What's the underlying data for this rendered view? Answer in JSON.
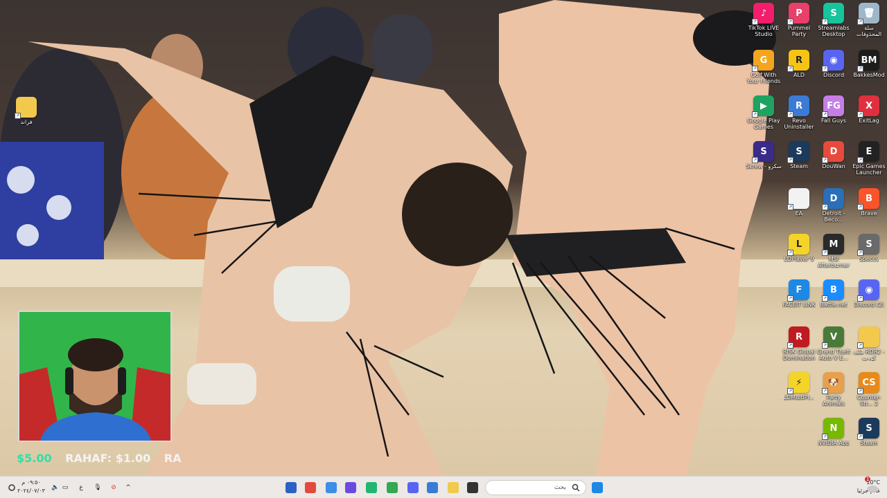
{
  "desktop_icons": [
    {
      "label": "TikTok LIVE Studio",
      "icon": "tiktok-icon",
      "color": "#f21d6b",
      "glyph": "♪"
    },
    {
      "label": "Pummel Party",
      "icon": "pummel-party-icon",
      "color": "#e83f6b",
      "glyph": "P"
    },
    {
      "label": "Streamlabs Desktop",
      "icon": "streamlabs-icon",
      "color": "#17c49b",
      "glyph": "S"
    },
    {
      "label": "سلة المحذوفات",
      "icon": "recycle-bin-icon",
      "color": "#9fb6c9",
      "glyph": "🗑"
    },
    {
      "label": "Golf With Your Friends",
      "icon": "golf-icon",
      "color": "#f3a51d",
      "glyph": "G"
    },
    {
      "label": "ALD",
      "icon": "rockstar-icon",
      "color": "#f7c413",
      "glyph": "R"
    },
    {
      "label": "Discord",
      "icon": "discord-icon",
      "color": "#5865f2",
      "glyph": "◉"
    },
    {
      "label": "BakkesMod",
      "icon": "bakkesmod-icon",
      "color": "#1c1c1c",
      "glyph": "BM"
    },
    {
      "label": "Google Play Games",
      "icon": "google-play-games-icon",
      "color": "#1ea362",
      "glyph": "▶"
    },
    {
      "label": "Revo Uninstaller",
      "icon": "revo-uninstaller-icon",
      "color": "#3b7bd6",
      "glyph": "R"
    },
    {
      "label": "Fall Guys",
      "icon": "fall-guys-icon",
      "color": "#c67ee7",
      "glyph": "FG"
    },
    {
      "label": "ExitLag",
      "icon": "exitlag-icon",
      "color": "#e03040",
      "glyph": "X"
    },
    {
      "label": "Skrew - سكرو",
      "icon": "skrew-icon",
      "color": "#3a2a8a",
      "glyph": "S"
    },
    {
      "label": "Steam",
      "icon": "steam-icon",
      "color": "#1b3a5c",
      "glyph": "S"
    },
    {
      "label": "DouWan",
      "icon": "douwan-icon",
      "color": "#e84a3c",
      "glyph": "D"
    },
    {
      "label": "Epic Games Launcher",
      "icon": "epic-games-icon",
      "color": "#222222",
      "glyph": "E"
    },
    {
      "label": "EA",
      "icon": "ea-file-icon",
      "color": "#f2f2f2",
      "glyph": ""
    },
    {
      "label": "Detroit - Beco...",
      "icon": "detroit-icon",
      "color": "#2a6fb8",
      "glyph": "D"
    },
    {
      "label": "Brave",
      "icon": "brave-icon",
      "color": "#fb542b",
      "glyph": "B"
    },
    {
      "label": "LDPlayer 9",
      "icon": "ldplayer-icon",
      "color": "#f5d42a",
      "glyph": "L"
    },
    {
      "label": "MSI Afterburner",
      "icon": "msi-afterburner-icon",
      "color": "#2a2a2a",
      "glyph": "M"
    },
    {
      "label": "Speccy",
      "icon": "speccy-icon",
      "color": "#6a6a6a",
      "glyph": "S"
    },
    {
      "label": "FACEIT LINK",
      "icon": "faceit-icon",
      "color": "#1e88e5",
      "glyph": "F"
    },
    {
      "label": "Battle.net",
      "icon": "battlenet-icon",
      "color": "#1a8cff",
      "glyph": "B"
    },
    {
      "label": "Discord (2)",
      "icon": "discord-icon",
      "color": "#5865f2",
      "glyph": "◉"
    },
    {
      "label": "RISK Global Domination",
      "icon": "risk-icon",
      "color": "#c01a22",
      "glyph": "R"
    },
    {
      "label": "Grand Theft Auto V E...",
      "icon": "gta-v-icon",
      "color": "#4a7a3a",
      "glyph": "V"
    },
    {
      "label": "ملف RDR2 - كورب",
      "icon": "folder-icon",
      "color": "#f2c94c",
      "glyph": ""
    },
    {
      "label": "LDMultiPl...",
      "icon": "ldmultiplayer-icon",
      "color": "#f5d42a",
      "glyph": "⚡"
    },
    {
      "label": "Party Animals",
      "icon": "party-animals-icon",
      "color": "#e8a04c",
      "glyph": "🐶"
    },
    {
      "label": "Counter-Str... 2",
      "icon": "counter-strike-icon",
      "color": "#e88a1a",
      "glyph": "CS"
    },
    {
      "label": "NVIDIA App",
      "icon": "nvidia-icon",
      "color": "#76b900",
      "glyph": "N"
    },
    {
      "label": "Steam",
      "icon": "steam-icon",
      "color": "#1b3a5c",
      "glyph": "S"
    },
    {
      "label": "فراند",
      "icon": "folder-icon",
      "color": "#f2c94c",
      "glyph": ""
    }
  ],
  "overlay": {
    "donation_text_1": "$5.00",
    "donation_text_2": "RAHAF: $1.00",
    "donation_text_3": "RA"
  },
  "taskbar": {
    "clock_time": "٠٩:٥٠ م",
    "clock_date": "٢٠٢٤/٠٧/٠٣",
    "language": "ع",
    "search_placeholder": "بحث",
    "weather_temp": "10°C",
    "weather_desc": "غائم جزئيا",
    "notification_count": "1",
    "apps": [
      {
        "icon": "app-icon-1",
        "color": "#2b62c4"
      },
      {
        "icon": "chrome-icon",
        "color": "#e24b3b"
      },
      {
        "icon": "app-icon-3",
        "color": "#3d8ee6"
      },
      {
        "icon": "app-icon-4",
        "color": "#6b4ae0"
      },
      {
        "icon": "app-icon-5",
        "color": "#22b573"
      },
      {
        "icon": "chrome-icon",
        "color": "#34a853"
      },
      {
        "icon": "discord-icon",
        "color": "#5865f2"
      },
      {
        "icon": "store-icon",
        "color": "#3a7bd5"
      },
      {
        "icon": "file-explorer-icon",
        "color": "#f2c94c"
      },
      {
        "icon": "terminal-icon",
        "color": "#333333"
      },
      {
        "icon": "widgets-icon",
        "color": "#7cae4e"
      },
      {
        "icon": "windows-start-icon",
        "color": "#1e88e5"
      }
    ]
  }
}
